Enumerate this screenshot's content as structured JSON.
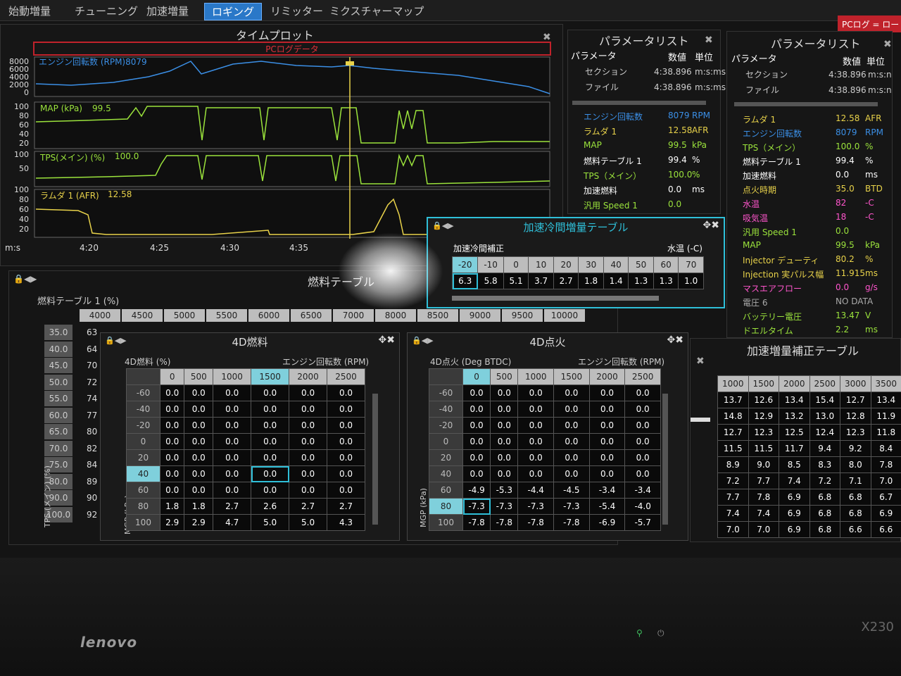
{
  "menu": {
    "items": [
      {
        "label": "始動増量"
      },
      {
        "label": "チューニング"
      },
      {
        "label": "加速増量"
      },
      {
        "label": "ロギング"
      },
      {
        "label": "リミッター"
      },
      {
        "label": "ミクスチャーマップ"
      }
    ],
    "active": "ロギング",
    "pclog_badge": "PCログ = ロー"
  },
  "timeplot": {
    "title": "タイムプロット",
    "banner": "PCログデータ",
    "time_label": "m:s",
    "time_ticks": [
      "4:20",
      "4:25",
      "4:30",
      "4:35"
    ],
    "channels": [
      {
        "label": "エンジン回転数 (RPM)8079",
        "axis": [
          "8000",
          "6000",
          "4000",
          "2000",
          "0"
        ],
        "color": "#3b8fe6"
      },
      {
        "label": "MAP (kPa)",
        "value": "99.5",
        "axis": [
          "100",
          "80",
          "60",
          "40",
          "20"
        ],
        "color": "#9be33c"
      },
      {
        "label": "TPS(メイン) (%)",
        "value": "100.0",
        "axis": [
          "100",
          "50"
        ],
        "color": "#9be33c"
      },
      {
        "label": "ラムダ 1 (AFR)",
        "value": "12.58",
        "axis": [
          "100",
          "80",
          "60",
          "40",
          "20"
        ],
        "color": "#e8d24a"
      }
    ]
  },
  "param_list_1": {
    "title": "パラメータリスト",
    "header": {
      "param": "パラメータ",
      "value": "数値",
      "unit": "単位"
    },
    "section": {
      "label": "セクション",
      "value": "4:38.896",
      "unit": "m:s:ms"
    },
    "file": {
      "label": "ファイル",
      "value": "4:38.896",
      "unit": "m:s:ms"
    },
    "rows": [
      {
        "name": "エンジン回転数",
        "value": "8079",
        "unit": "RPM",
        "color": "#3b8fe6"
      },
      {
        "name": "ラムダ 1",
        "value": "12.58",
        "unit": "AFR",
        "color": "#e8d24a"
      },
      {
        "name": "MAP",
        "value": "99.5",
        "unit": "kPa",
        "color": "#9be33c"
      },
      {
        "name": "燃料テーブル 1",
        "value": "99.4",
        "unit": "%",
        "color": "#ffffff"
      },
      {
        "name": "TPS（メイン）",
        "value": "100.0",
        "unit": "%",
        "color": "#9be33c"
      },
      {
        "name": "加速燃料",
        "value": "0.0",
        "unit": "ms",
        "color": "#ffffff"
      },
      {
        "name": "汎用 Speed 1",
        "value": "0.0",
        "unit": "",
        "color": "#9be33c"
      }
    ]
  },
  "param_list_2": {
    "title": "パラメータリスト",
    "header": {
      "param": "パラメータ",
      "value": "数値",
      "unit": "単位"
    },
    "section": {
      "label": "セクション",
      "value": "4:38.896",
      "unit": "m:s:n"
    },
    "file": {
      "label": "ファイル",
      "value": "4:38.896",
      "unit": "m:s:n"
    },
    "rows": [
      {
        "name": "ラムダ 1",
        "value": "12.58",
        "unit": "AFR",
        "color": "#e8d24a"
      },
      {
        "name": "エンジン回転数",
        "value": "8079",
        "unit": "RPM",
        "color": "#3b8fe6"
      },
      {
        "name": "TPS（メイン）",
        "value": "100.0",
        "unit": "%",
        "color": "#9be33c"
      },
      {
        "name": "燃料テーブル 1",
        "value": "99.4",
        "unit": "%",
        "color": "#ffffff"
      },
      {
        "name": "加速燃料",
        "value": "0.0",
        "unit": "ms",
        "color": "#ffffff"
      },
      {
        "name": "点火時期",
        "value": "35.0",
        "unit": "BTD",
        "color": "#e8d24a"
      },
      {
        "name": "水温",
        "value": "82",
        "unit": "-C",
        "color": "#ff55cc"
      },
      {
        "name": "吸気温",
        "value": "18",
        "unit": "-C",
        "color": "#ff55cc"
      },
      {
        "name": "汎用 Speed 1",
        "value": "0.0",
        "unit": "",
        "color": "#9be33c"
      },
      {
        "name": "MAP",
        "value": "99.5",
        "unit": "kPa",
        "color": "#9be33c"
      },
      {
        "name": "Injector デューティ",
        "value": "80.2",
        "unit": "%",
        "color": "#e8d24a"
      },
      {
        "name": "Injection 実パルス幅",
        "value": "11.915",
        "unit": "ms",
        "color": "#e8d24a"
      },
      {
        "name": "マスエアフロー",
        "value": "0.0",
        "unit": "g/s",
        "color": "#ff55cc"
      },
      {
        "name": "電圧 6",
        "value": "NO DATA",
        "unit": "",
        "color": "#aaaaaa"
      },
      {
        "name": "バッテリー電圧",
        "value": "13.47",
        "unit": "V",
        "color": "#9be33c"
      },
      {
        "name": "ドエルタイム",
        "value": "2.2",
        "unit": "ms",
        "color": "#9be33c"
      }
    ]
  },
  "cold_accel": {
    "title": "加速冷間増量テーブル",
    "label_left": "加速冷間補正",
    "label_right": "水温 (-C)",
    "temps": [
      "-20",
      "-10",
      "0",
      "10",
      "20",
      "30",
      "40",
      "50",
      "60",
      "70"
    ],
    "values": [
      "6.3",
      "5.8",
      "5.1",
      "3.7",
      "2.7",
      "1.8",
      "1.4",
      "1.3",
      "1.3",
      "1.0"
    ]
  },
  "fuel_table": {
    "title": "燃料テーブル",
    "label": "燃料テーブル 1 (%)",
    "rpm": [
      "4000",
      "4500",
      "5000",
      "5500",
      "6000",
      "6500",
      "7000",
      "8000",
      "8500",
      "9000",
      "9500",
      "10000"
    ],
    "tps": [
      "35.0",
      "40.0",
      "45.0",
      "50.0",
      "55.0",
      "60.0",
      "65.0",
      "70.0",
      "75.0",
      "80.0",
      "90.0",
      "100.0"
    ],
    "first_col": [
      "63",
      "64",
      "70",
      "72",
      "74",
      "77",
      "80",
      "82",
      "84",
      "89",
      "90",
      "92"
    ],
    "axis_label": "TPS (メイン) (%)"
  },
  "fuel_4d": {
    "title": "4D燃料",
    "label": "4D燃料 (%)",
    "rpm_label": "エンジン回転数 (RPM)",
    "rpm": [
      "0",
      "500",
      "1000",
      "1500",
      "2000",
      "2500"
    ],
    "mgp": [
      "-60",
      "-40",
      "-20",
      "0",
      "20",
      "40",
      "60",
      "80",
      "100"
    ],
    "axis_label": "MGP (kPa)",
    "rows": [
      [
        "0.0",
        "0.0",
        "0.0",
        "0.0",
        "0.0",
        "0.0"
      ],
      [
        "0.0",
        "0.0",
        "0.0",
        "0.0",
        "0.0",
        "0.0"
      ],
      [
        "0.0",
        "0.0",
        "0.0",
        "0.0",
        "0.0",
        "0.0"
      ],
      [
        "0.0",
        "0.0",
        "0.0",
        "0.0",
        "0.0",
        "0.0"
      ],
      [
        "0.0",
        "0.0",
        "0.0",
        "0.0",
        "0.0",
        "0.0"
      ],
      [
        "0.0",
        "0.0",
        "0.0",
        "0.0",
        "0.0",
        "0.0"
      ],
      [
        "0.0",
        "0.0",
        "0.0",
        "0.0",
        "0.0",
        "0.0"
      ],
      [
        "1.8",
        "1.8",
        "2.7",
        "2.6",
        "2.7",
        "2.7"
      ],
      [
        "2.9",
        "2.9",
        "4.7",
        "5.0",
        "5.0",
        "4.3"
      ]
    ]
  },
  "ign_4d": {
    "title": "4D点火",
    "label": "4D点火 (Deg BTDC)",
    "rpm_label": "エンジン回転数 (RPM)",
    "rpm": [
      "0",
      "500",
      "1000",
      "1500",
      "2000",
      "2500"
    ],
    "mgp": [
      "-60",
      "-40",
      "-20",
      "0",
      "20",
      "40",
      "60",
      "80",
      "100"
    ],
    "axis_label": "MGP (kPa)",
    "rows": [
      [
        "0.0",
        "0.0",
        "0.0",
        "0.0",
        "0.0",
        "0.0"
      ],
      [
        "0.0",
        "0.0",
        "0.0",
        "0.0",
        "0.0",
        "0.0"
      ],
      [
        "0.0",
        "0.0",
        "0.0",
        "0.0",
        "0.0",
        "0.0"
      ],
      [
        "0.0",
        "0.0",
        "0.0",
        "0.0",
        "0.0",
        "0.0"
      ],
      [
        "0.0",
        "0.0",
        "0.0",
        "0.0",
        "0.0",
        "0.0"
      ],
      [
        "0.0",
        "0.0",
        "0.0",
        "0.0",
        "0.0",
        "0.0"
      ],
      [
        "-4.9",
        "-5.3",
        "-4.4",
        "-4.5",
        "-3.4",
        "-3.4"
      ],
      [
        "-7.3",
        "-7.3",
        "-7.3",
        "-7.3",
        "-5.4",
        "-4.0"
      ],
      [
        "-7.8",
        "-7.8",
        "-7.8",
        "-7.8",
        "-6.9",
        "-5.7"
      ]
    ]
  },
  "accel_table": {
    "title": "加速増量補正テーブル",
    "rpm": [
      "1000",
      "1500",
      "2000",
      "2500",
      "3000",
      "3500"
    ],
    "rows": [
      [
        "13.7",
        "12.6",
        "13.4",
        "15.4",
        "12.7",
        "13.4"
      ],
      [
        "14.8",
        "12.9",
        "13.2",
        "13.0",
        "12.8",
        "11.9"
      ],
      [
        "12.7",
        "12.3",
        "12.5",
        "12.4",
        "12.3",
        "11.8"
      ],
      [
        "11.5",
        "11.5",
        "11.7",
        "9.4",
        "9.2",
        "8.4"
      ],
      [
        "8.9",
        "9.0",
        "8.5",
        "8.3",
        "8.0",
        "7.8"
      ],
      [
        "7.2",
        "7.7",
        "7.4",
        "7.2",
        "7.1",
        "7.0"
      ],
      [
        "7.7",
        "7.8",
        "6.9",
        "6.8",
        "6.8",
        "6.7"
      ],
      [
        "7.4",
        "7.4",
        "6.9",
        "6.8",
        "6.8",
        "6.9"
      ],
      [
        "7.0",
        "7.0",
        "6.9",
        "6.8",
        "6.6",
        "6.6"
      ]
    ]
  },
  "laptop": {
    "brand": "lenovo",
    "model": "X230"
  }
}
